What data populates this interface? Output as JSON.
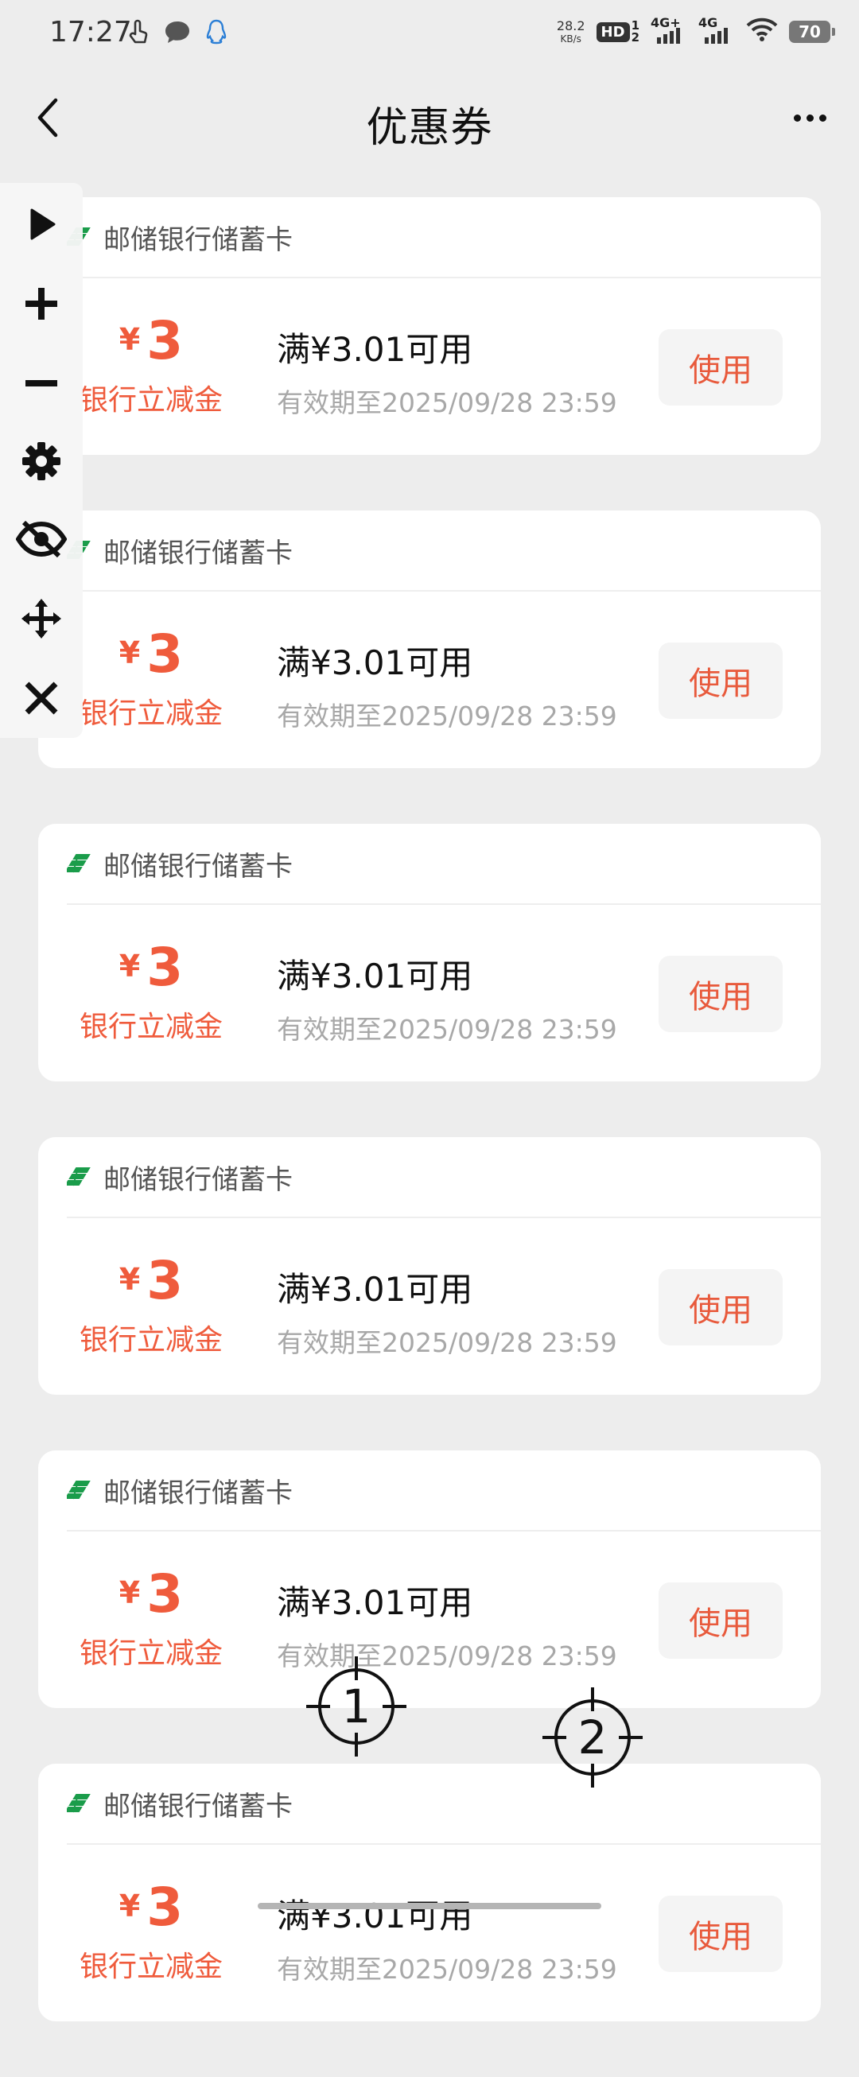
{
  "status_bar": {
    "time": "17:27",
    "net_speed_value": "28.2",
    "net_speed_unit": "KB/s",
    "hd_label": "HD",
    "hd_sub": "1",
    "hd_sub2": "2",
    "sim1_label": "4G+",
    "sim2_label": "4G",
    "battery": "70",
    "left_icons": [
      "touch-gesture-icon",
      "message-bubble-icon",
      "qq-penguin-icon"
    ]
  },
  "nav": {
    "title": "优惠券",
    "back_icon": "chevron-left-icon",
    "more_icon": "more-dots-icon"
  },
  "colors": {
    "accent_red": "#ef5b3c",
    "bank_logo_green": "#1a9c4a",
    "background": "#ededed"
  },
  "coupons": [
    {
      "bank": "邮储银行储蓄卡",
      "currency": "¥",
      "amount": "3",
      "label": "银行立减金",
      "condition": "满¥3.01可用",
      "expiry": "有效期至2025/09/28  23:59",
      "button": "使用"
    },
    {
      "bank": "邮储银行储蓄卡",
      "currency": "¥",
      "amount": "3",
      "label": "银行立减金",
      "condition": "满¥3.01可用",
      "expiry": "有效期至2025/09/28  23:59",
      "button": "使用"
    },
    {
      "bank": "邮储银行储蓄卡",
      "currency": "¥",
      "amount": "3",
      "label": "银行立减金",
      "condition": "满¥3.01可用",
      "expiry": "有效期至2025/09/28  23:59",
      "button": "使用"
    },
    {
      "bank": "邮储银行储蓄卡",
      "currency": "¥",
      "amount": "3",
      "label": "银行立减金",
      "condition": "满¥3.01可用",
      "expiry": "有效期至2025/09/28  23:59",
      "button": "使用"
    },
    {
      "bank": "邮储银行储蓄卡",
      "currency": "¥",
      "amount": "3",
      "label": "银行立减金",
      "condition": "满¥3.01可用",
      "expiry": "有效期至2025/09/28  23:59",
      "button": "使用"
    },
    {
      "bank": "邮储银行储蓄卡",
      "currency": "¥",
      "amount": "3",
      "label": "银行立减金",
      "condition": "满¥3.01可用",
      "expiry": "有效期至2025/09/28  23:59",
      "button": "使用"
    }
  ],
  "toolbar": {
    "tools": [
      "play-icon",
      "plus-icon",
      "minus-icon",
      "gear-icon",
      "eye-off-icon",
      "move-icon",
      "close-icon"
    ]
  },
  "markers": [
    {
      "label": "1"
    },
    {
      "label": "2"
    }
  ]
}
